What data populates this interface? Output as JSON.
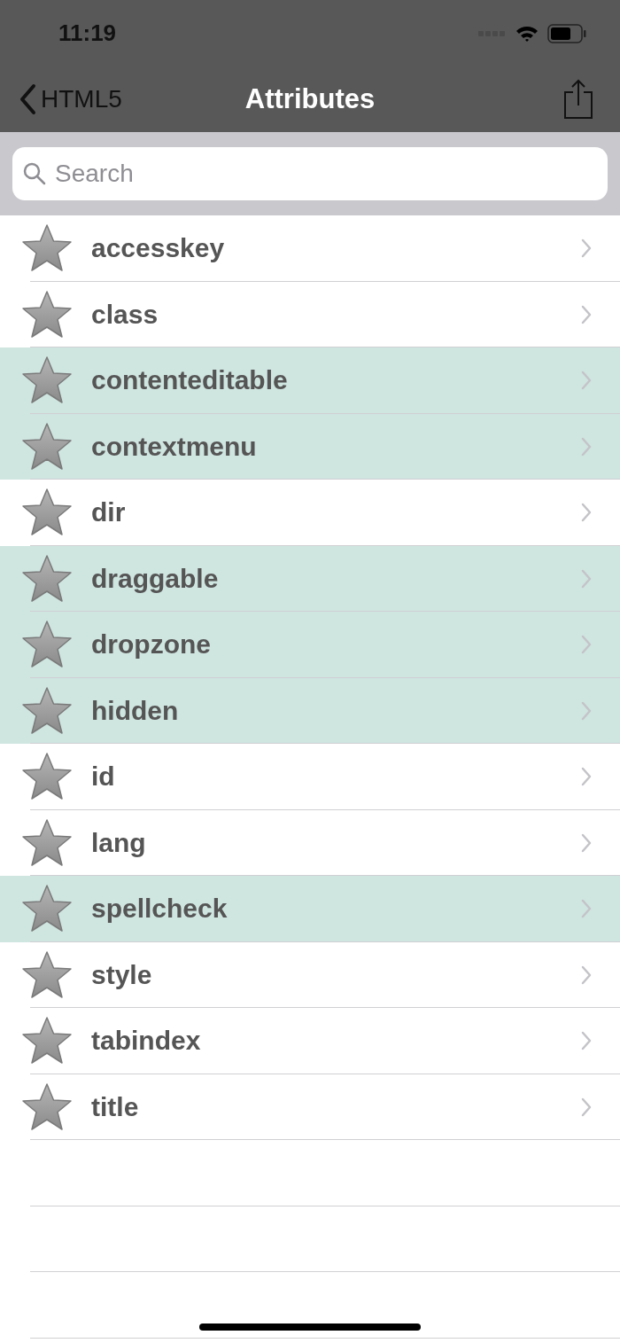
{
  "status_bar": {
    "time": "11:19"
  },
  "nav_bar": {
    "back_label": "HTML5",
    "title": "Attributes"
  },
  "search": {
    "placeholder": "Search"
  },
  "rows": [
    {
      "label": "accesskey",
      "highlighted": false
    },
    {
      "label": "class",
      "highlighted": false
    },
    {
      "label": "contenteditable",
      "highlighted": true
    },
    {
      "label": "contextmenu",
      "highlighted": true
    },
    {
      "label": "dir",
      "highlighted": false
    },
    {
      "label": "draggable",
      "highlighted": true
    },
    {
      "label": "dropzone",
      "highlighted": true
    },
    {
      "label": "hidden",
      "highlighted": true
    },
    {
      "label": "id",
      "highlighted": false
    },
    {
      "label": "lang",
      "highlighted": false
    },
    {
      "label": "spellcheck",
      "highlighted": true
    },
    {
      "label": "style",
      "highlighted": false
    },
    {
      "label": "tabindex",
      "highlighted": false
    },
    {
      "label": "title",
      "highlighted": false
    }
  ]
}
